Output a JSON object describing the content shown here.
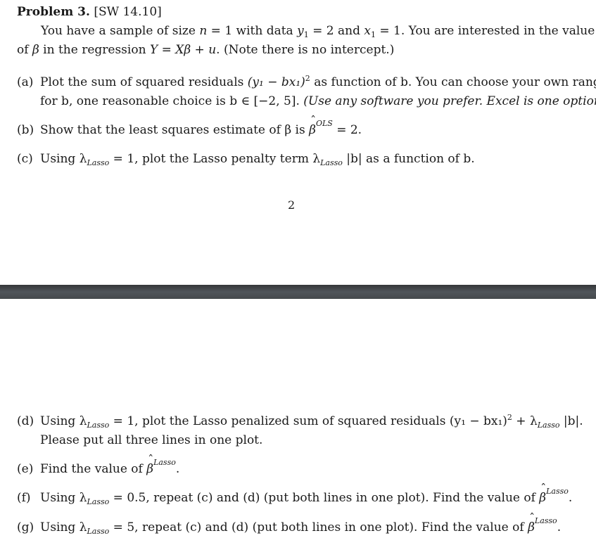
{
  "page1": {
    "heading": {
      "title": "Problem 3.",
      "source": "[SW 14.10]"
    },
    "intro": {
      "line1_prefix": "You have a sample of size ",
      "n_var": "n",
      "n_eq": " = 1 with data ",
      "y_var": "y",
      "y_sub": "1",
      "y_eq": " = 2 and ",
      "x_var": "x",
      "x_sub": "1",
      "x_eq": " = 1. You are interested in the value",
      "line2_prefix": "of ",
      "beta": "β",
      "line2_mid": " in the regression ",
      "model": "Y = Xβ + u",
      "line2_suffix": ". (Note there is no intercept.)"
    },
    "parts": {
      "a": {
        "label": "(a)",
        "line1_prefix": "Plot the sum of squared residuals ",
        "expr": "(y₁ − bx₁)",
        "exp": "2",
        "line1_suffix": " as function of b. You can choose your own range",
        "line2_prefix": "for b, one reasonable choice is b ∈ [−2, 5]. ",
        "line2_italic": "(Use any software you prefer. Excel is one option.)"
      },
      "b": {
        "label": "(b)",
        "prefix": "Show that the least squares estimate of β is ",
        "hat_symbol": "β",
        "hat_sup": "OLS",
        "suffix": " = 2."
      },
      "c": {
        "label": "(c)",
        "prefix": "Using λ",
        "sub": "Lasso",
        "mid": " = 1, plot the Lasso penalty term λ",
        "sub2": "Lasso",
        "suffix": " |b| as a function of b."
      }
    },
    "page_number": "2"
  },
  "page2": {
    "parts": {
      "d": {
        "label": "(d)",
        "prefix": "Using λ",
        "sub": "Lasso",
        "mid": " = 1, plot the Lasso penalized sum of squared residuals (y₁ − bx₁)",
        "exp": "2",
        "mid2": " + λ",
        "sub2": "Lasso",
        "suffix": " |b|.",
        "line2": "Please put all three lines in one plot."
      },
      "e": {
        "label": "(e)",
        "prefix": "Find the value of ",
        "hat_symbol": "β",
        "hat_sup": "Lasso",
        "suffix": "."
      },
      "f": {
        "label": "(f)",
        "prefix": "Using λ",
        "sub": "Lasso",
        "mid": " = 0.5, repeat (c) and (d) (put both lines in one plot). Find the value of ",
        "hat_symbol": "β",
        "hat_sup": "Lasso",
        "suffix": "."
      },
      "g": {
        "label": "(g)",
        "prefix": "Using λ",
        "sub": "Lasso",
        "mid": " = 5, repeat (c) and (d) (put both lines in one plot). Find the value of ",
        "hat_symbol": "β",
        "hat_sup": "Lasso",
        "suffix": "."
      }
    }
  }
}
